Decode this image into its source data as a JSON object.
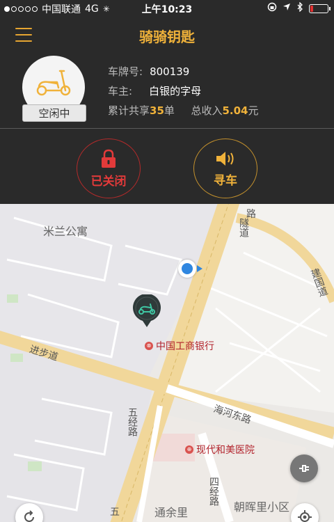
{
  "status_bar": {
    "carrier": "中国联通",
    "network": "4G",
    "time": "上午10:23",
    "battery_level": 0.15
  },
  "navbar": {
    "title": "骑骑钥匙",
    "menu_icon": "hamburger-menu-icon"
  },
  "vehicle": {
    "status": "空闲中",
    "plate_label": "车牌号:",
    "plate_value": "800139",
    "owner_label": "车主:",
    "owner_value": "白银的字母",
    "share_prefix": "累计共享",
    "share_count": "35",
    "share_suffix": "单",
    "income_prefix": "总收入",
    "income_value": "5.04",
    "income_suffix": "元"
  },
  "actions": {
    "lock_label": "已关闭",
    "find_label": "寻车"
  },
  "map": {
    "labels": {
      "milan": "米兰公寓",
      "bank": "中国工商银行",
      "jinbu": "进步道",
      "haihe": "海河东路",
      "hospital": "现代和美医院",
      "wujing": "五经路",
      "sijing": "四经路",
      "tongyu": "通余里",
      "chaohui": "朝晖里小区",
      "jianguo": "建国道",
      "lu": "路",
      "suidao": "隧道",
      "wu": "五"
    }
  },
  "colors": {
    "accent": "#f0b23a",
    "danger": "#e23a3a",
    "background": "#2a2a2a"
  }
}
